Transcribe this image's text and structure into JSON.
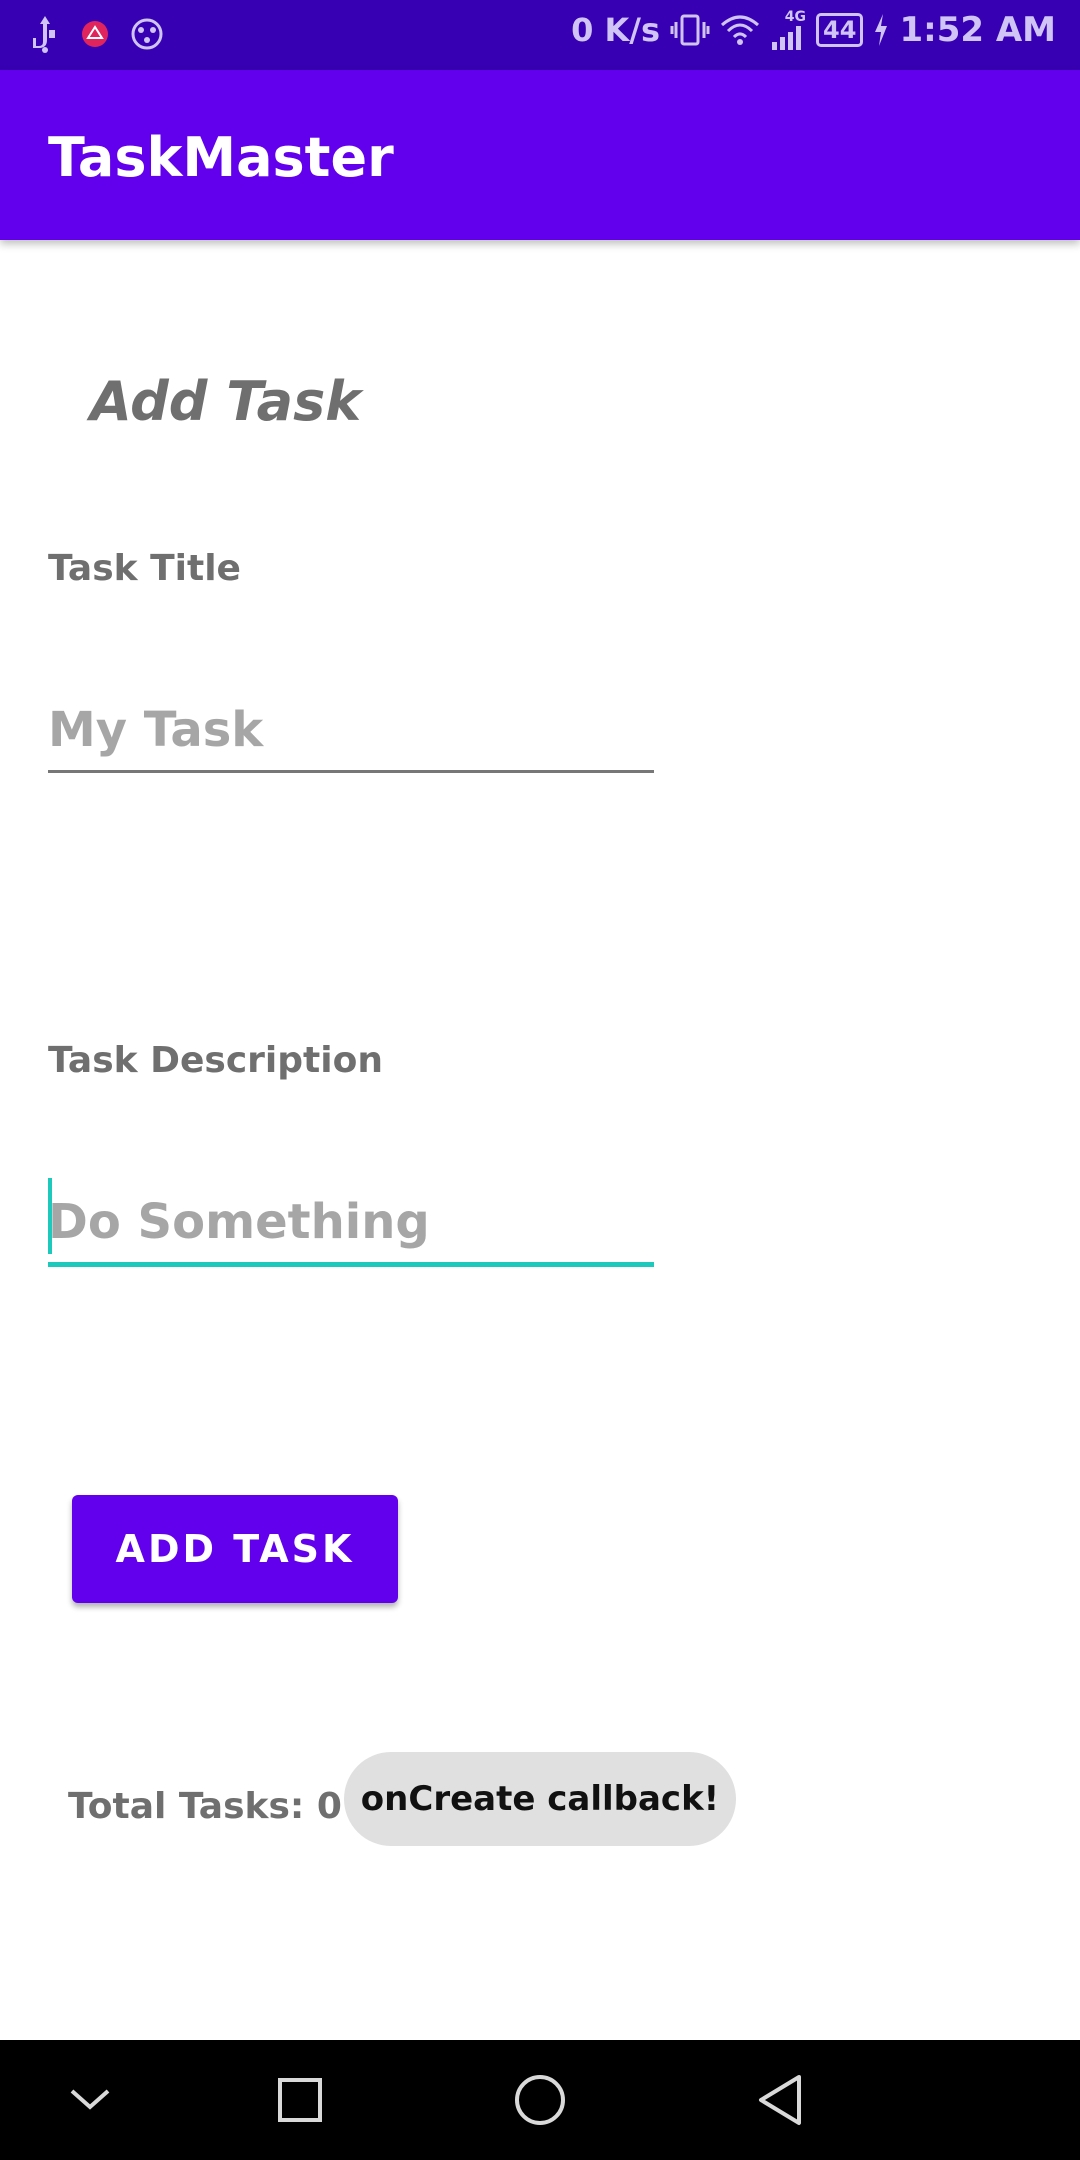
{
  "status_bar": {
    "network_speed": "0 K/s",
    "network_type": "4G",
    "battery_level": "44",
    "time": "1:52 AM",
    "left_icons": [
      "usb-icon",
      "notification-icon",
      "ball-icon"
    ],
    "right_icons": [
      "vibrate-icon",
      "wifi-icon",
      "signal-icon",
      "battery-icon",
      "charging-icon"
    ]
  },
  "app_bar": {
    "title": "TaskMaster"
  },
  "form": {
    "heading": "Add Task",
    "title_label": "Task Title",
    "title_placeholder": "My Task",
    "title_value": "",
    "description_label": "Task Description",
    "description_placeholder": "Do Something",
    "description_value": "",
    "submit_label": "ADD TASK"
  },
  "footer": {
    "total_tasks": "Total Tasks: 0"
  },
  "toast": {
    "message": "onCreate callback!"
  },
  "nav_bar": {
    "buttons": [
      "chevron-down-icon",
      "recents-icon",
      "home-icon",
      "back-icon"
    ]
  },
  "colors": {
    "status_bar": "#3700b3",
    "primary": "#6200ee",
    "accent": "#1cc9bc",
    "label_text": "#6f6f6f",
    "toast_bg": "#e0e0e0"
  }
}
